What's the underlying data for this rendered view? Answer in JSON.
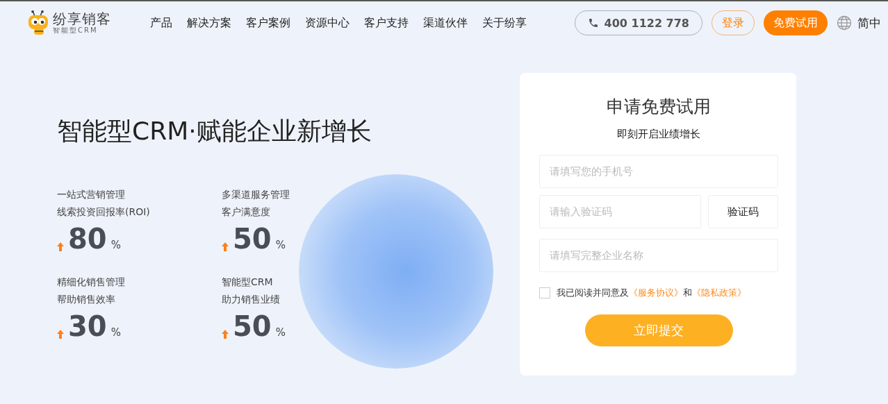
{
  "header": {
    "logo": {
      "name": "纷享销客",
      "tagline": "智能型CRM"
    },
    "nav": [
      "产品",
      "解决方案",
      "客户案例",
      "资源中心",
      "客户支持",
      "渠道伙伴",
      "关于纷享"
    ],
    "phone": "400 1122 778",
    "login": "登录",
    "trial": "免费试用",
    "language": "简中"
  },
  "hero": {
    "title": "智能型CRM·赋能企业新增长",
    "stats": [
      {
        "category": "一站式营销管理",
        "metric": "线索投资回报率(ROI)",
        "value": "80",
        "unit": "%"
      },
      {
        "category": "多渠道服务管理",
        "metric": "客户满意度",
        "value": "50",
        "unit": "%"
      },
      {
        "category": "精细化销售管理",
        "metric": "帮助销售效率",
        "value": "30",
        "unit": "%"
      },
      {
        "category": "智能型CRM",
        "metric": "助力销售业绩",
        "value": "50",
        "unit": "%"
      }
    ]
  },
  "form": {
    "title": "申请免费试用",
    "subtitle": "即刻开启业绩增长",
    "phone_field": {
      "placeholder": "请填写您的手机号"
    },
    "code_field": {
      "placeholder": "请输入验证码"
    },
    "code_button": "验证码",
    "company_field": {
      "placeholder": "请填写完整企业名称"
    },
    "agreement": {
      "checked": false,
      "text_before": "我已阅读并同意及",
      "link_1": "《服务协议》",
      "conjunction": "和",
      "link_2": "《隐私政策》"
    },
    "submit": "立即提交"
  }
}
